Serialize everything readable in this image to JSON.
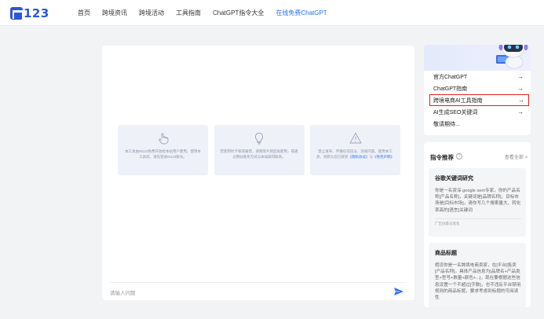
{
  "logo": {
    "text": "123"
  },
  "nav": {
    "items": [
      {
        "label": "首页"
      },
      {
        "label": "跨境资讯"
      },
      {
        "label": "跨境活动"
      },
      {
        "label": "工具指南"
      },
      {
        "label": "ChatGPT指令大全"
      },
      {
        "label": "在线免费ChatGPT"
      }
    ],
    "active_color": "#2a6ff0"
  },
  "chat": {
    "cards": [
      {
        "icon": "tap-hand-icon",
        "text": "本工具由M123免费开放给本站用户使用。使用本工具前，请先登录M123账号。"
      },
      {
        "icon": "lightbulb-icon",
        "text": "若使用时卡顿或报错，请稍等片刻后再使用，或通过网站联系方式与本站取得联系。"
      },
      {
        "icon": "warning-icon",
        "text": "禁止发布、传播任何违法、违规内容。使用本工具，则默认您已接受",
        "link1": "《隐私协议》",
        "and": "与",
        "link2": "《免责声明》"
      }
    ],
    "input_placeholder": "请输入问题",
    "send_icon": "send-icon"
  },
  "side_links": [
    {
      "label": "官方ChatGPT"
    },
    {
      "label": "ChatGPT指南"
    },
    {
      "label": "跨境电商AI工具指南",
      "highlighted": true
    },
    {
      "label": "AI生成SEO关键词"
    },
    {
      "label": "敬请期待..."
    }
  ],
  "prompts": {
    "title": "指令推荐",
    "view_all": "查看全部 >",
    "cards": [
      {
        "title": "谷歌关键词研究",
        "desc": "你是一名资深 google sem专家，你的产品名称[产品名称]，关键词是[品牌名称]，目标市场是[目标市场]，请你写几个搜索量大、转化率高的[语言]关键词",
        "tag": "广告创意与优化"
      },
      {
        "title": "商品标题",
        "desc": "假设你是一名跨境电商卖家，在[平台]售卖[产品名称]，具体产品信息为[品牌名+产品类型+型号+数量+颜色+...]，现在要根据这些信息设置一个不超过[字数]，也不违反平台禁用规则的商品标题，要求考虑到标题的可阅读性",
        "tag": ""
      }
    ]
  }
}
